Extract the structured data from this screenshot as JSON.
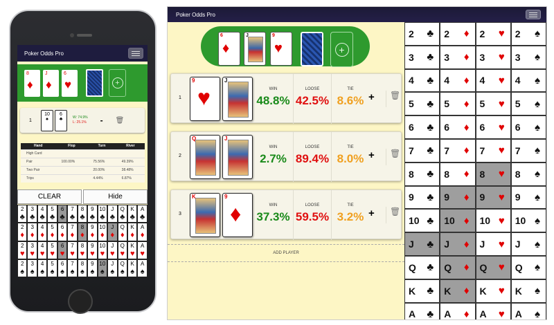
{
  "colors": {
    "red": "#e00000",
    "black": "#111111",
    "win": "#1a8a1a",
    "loose": "#e01010",
    "tie": "#f0a020",
    "felt": "#2e9a2e",
    "navbar": "#1e1c3e"
  },
  "app": {
    "title": "Poker Odds Pro"
  },
  "mobile": {
    "title": "Poker Odds Pro",
    "board": [
      {
        "rank": "8",
        "suit": "♦",
        "color": "#e00000"
      },
      {
        "rank": "J",
        "suit": "♦",
        "color": "#e00000"
      },
      {
        "rank": "6",
        "suit": "♥",
        "color": "#e00000"
      }
    ],
    "player": {
      "number": "1",
      "cards": [
        {
          "rank": "10",
          "suit": "♠"
        },
        {
          "rank": "6",
          "suit": "♣"
        }
      ],
      "win": "W: 74.9%",
      "loss": "L: 25.1%"
    },
    "hand_table": {
      "headers": [
        "Hand",
        "Flop",
        "Turn",
        "River"
      ],
      "rows": [
        [
          "High Card",
          "",
          "",
          ""
        ],
        [
          "Pair",
          "100.00%",
          "75.56%",
          "49.39%"
        ],
        [
          "Two Pair",
          "",
          "20.00%",
          "38.48%"
        ],
        [
          "Trips",
          "",
          "4.44%",
          "6.87%"
        ]
      ]
    },
    "buttons": {
      "clear": "CLEAR",
      "hide": "Hide"
    },
    "ranks": [
      "2",
      "3",
      "4",
      "5",
      "6",
      "7",
      "8",
      "9",
      "10",
      "J",
      "Q",
      "K",
      "A"
    ],
    "suits": [
      {
        "symbol": "♣",
        "color": "#111111"
      },
      {
        "symbol": "♦",
        "color": "#e00000"
      },
      {
        "symbol": "♥",
        "color": "#e00000"
      },
      {
        "symbol": "♠",
        "color": "#111111"
      }
    ],
    "selected": [
      "8-♦",
      "J-♦",
      "6-♥",
      "10-♠",
      "6-♣"
    ]
  },
  "desktop": {
    "title": "Poker Odds Pro",
    "board": [
      {
        "rank": "6",
        "suit": "♦",
        "color": "#e00000",
        "face": false
      },
      {
        "rank": "J",
        "suit": "♣",
        "color": "#111111",
        "face": true
      },
      {
        "rank": "9",
        "suit": "♥",
        "color": "#e00000",
        "face": false
      }
    ],
    "labels": {
      "win": "WIN",
      "loose": "LOOSE",
      "tie": "TIE",
      "plus": "+",
      "add_player": "ADD PLAYER"
    },
    "players": [
      {
        "number": "1",
        "cards": [
          {
            "rank": "9",
            "suit": "♥",
            "color": "#e00000",
            "face": false
          },
          {
            "rank": "J",
            "suit": "♣",
            "color": "#111111",
            "face": true
          }
        ],
        "win": "48.8%",
        "loose": "42.5%",
        "tie": "8.6%"
      },
      {
        "number": "2",
        "cards": [
          {
            "rank": "Q",
            "suit": "♥",
            "color": "#e00000",
            "face": true
          },
          {
            "rank": "J",
            "suit": "♦",
            "color": "#e00000",
            "face": true
          }
        ],
        "win": "2.7%",
        "loose": "89.4%",
        "tie": "8.0%"
      },
      {
        "number": "3",
        "cards": [
          {
            "rank": "K",
            "suit": "♦",
            "color": "#e00000",
            "face": true
          },
          {
            "rank": "9",
            "suit": "♦",
            "color": "#e00000",
            "face": false
          }
        ],
        "win": "37.3%",
        "loose": "59.5%",
        "tie": "3.2%"
      }
    ],
    "ranks": [
      "2",
      "3",
      "4",
      "5",
      "6",
      "7",
      "8",
      "9",
      "10",
      "J",
      "Q",
      "K",
      "A"
    ],
    "suits": [
      {
        "symbol": "♣",
        "color": "#111111"
      },
      {
        "symbol": "♦",
        "color": "#e00000"
      },
      {
        "symbol": "♥",
        "color": "#e00000"
      },
      {
        "symbol": "♠",
        "color": "#111111"
      }
    ],
    "selected": [
      "8-♥",
      "9-♦",
      "9-♥",
      "10-♦",
      "J-♣",
      "J-♦",
      "Q-♦",
      "Q-♥",
      "K-♦"
    ]
  }
}
